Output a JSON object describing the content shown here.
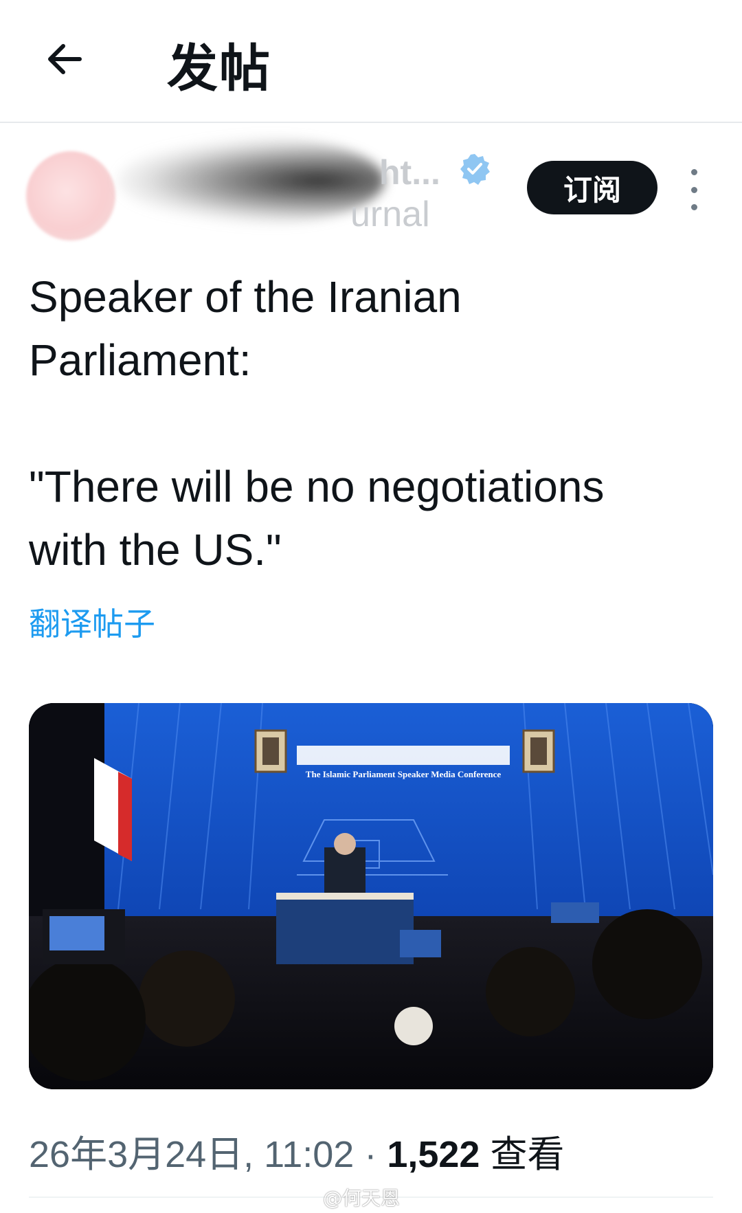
{
  "header": {
    "title": "发帖"
  },
  "author": {
    "display_name": "ht...",
    "handle": "urnal",
    "subscribe_label": "订阅"
  },
  "post": {
    "text": "Speaker of the Iranian\nParliament:\n\n\"There will be no negotiations\nwith the US.\"",
    "translate_label": "翻译帖子"
  },
  "media": {
    "banner_title_en": "The Islamic Parliament Speaker Media Conference"
  },
  "meta": {
    "datetime": "26年3月24日, 11:02",
    "separator": "·",
    "views_count": "1,522",
    "views_label": "查看"
  },
  "watermark": "@何天恩",
  "colors": {
    "accent": "#1d9bf0",
    "text": "#0f1419",
    "muted": "#536471"
  }
}
